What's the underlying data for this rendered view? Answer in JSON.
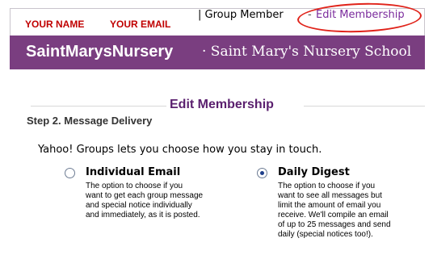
{
  "top_bar": {
    "name_link": "YOUR NAME",
    "email_link": "YOUR EMAIL",
    "member_status": "| Group Member",
    "separator": "-",
    "edit_link": "Edit Membership"
  },
  "group_bar": {
    "group_name": "SaintMarysNursery",
    "group_desc": "· Saint Mary's Nursery School"
  },
  "main": {
    "section_title": "Edit Membership",
    "step_title": "Step 2. Message Delivery",
    "intro": "Yahoo! Groups lets you choose how you stay in touch.",
    "options": [
      {
        "label": "Individual Email",
        "selected": false,
        "desc_lines": [
          "The option to choose if you",
          "want to get each group message",
          "and special notice individually",
          "and immediately, as it is posted."
        ]
      },
      {
        "label": "Daily Digest",
        "selected": true,
        "desc_lines": [
          "The option to choose if you",
          "want to see all messages but",
          "limit the amount of email you",
          "receive. We'll compile an email",
          "of up to 25 messages and send",
          "daily (special notices too!)."
        ]
      }
    ]
  },
  "colors": {
    "group_bar_bg": "#7a3e80",
    "top_links": "#c00000",
    "edit_link": "#7a2a9c",
    "annotation_circle": "#e0231a"
  }
}
